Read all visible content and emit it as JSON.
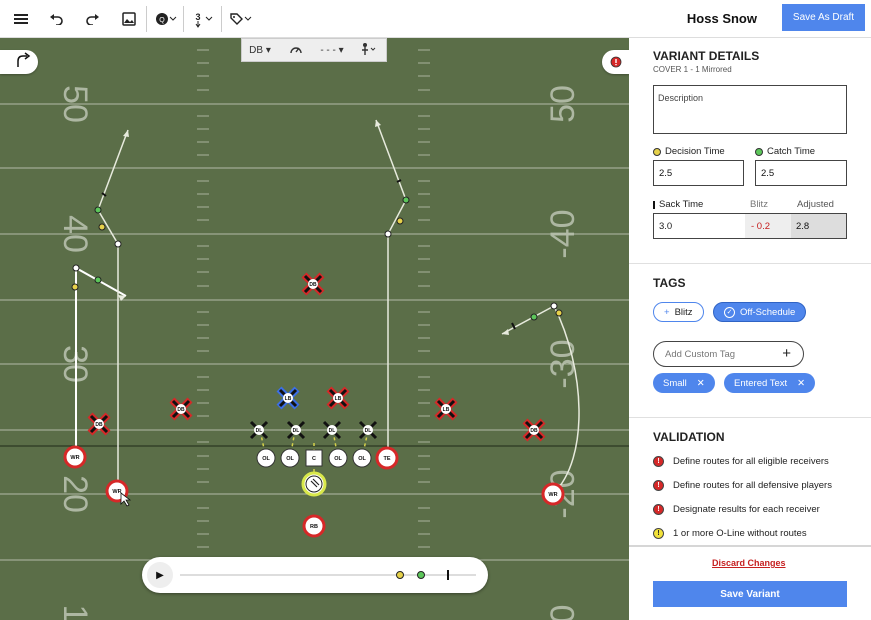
{
  "header": {
    "user_name": "Hoss Snow",
    "save_draft_label": "Save As Draft",
    "icons": [
      "menu-icon",
      "undo-icon",
      "redo-icon",
      "image-icon",
      "formation-icon",
      "motion-icon",
      "tag-icon"
    ]
  },
  "field_toolbar": {
    "player_select": "DB",
    "speed_icon": "gauge-icon",
    "line_style": "- - -",
    "motion_icon": "motion-icon"
  },
  "field": {
    "yard_numbers_left": [
      "50",
      "40",
      "30",
      "20",
      "1"
    ],
    "yard_numbers_right": [
      "50",
      "-40",
      "-30",
      "-20",
      "0"
    ],
    "players": {
      "offense": [
        "WR",
        "WR",
        "OL",
        "OL",
        "C",
        "OL",
        "OL",
        "TE",
        "RB",
        "WR"
      ],
      "defense": [
        "DB",
        "DB",
        "DB",
        "LB",
        "LB",
        "LB",
        "DL",
        "DL",
        "DL",
        "DL",
        "DB"
      ]
    }
  },
  "playback": {
    "play_icon": "play-icon"
  },
  "details": {
    "title": "VARIANT DETAILS",
    "subtitle": "COVER 1 - 1  Mirrored",
    "description_placeholder": "Description",
    "decision_time_label": "Decision Time",
    "decision_time_value": "2.5",
    "catch_time_label": "Catch Time",
    "catch_time_value": "2.5",
    "sack_time_label": "Sack Time",
    "sack_time_value": "3.0",
    "blitz_label": "Blitz",
    "blitz_value": "- 0.2",
    "adjusted_label": "Adjusted",
    "adjusted_value": "2.8"
  },
  "tags": {
    "title": "TAGS",
    "preset": [
      {
        "label": "Blitz",
        "selected": false
      },
      {
        "label": "Off-Schedule",
        "selected": true
      }
    ],
    "custom_placeholder": "Add Custom Tag",
    "applied": [
      "Small",
      "Entered Text"
    ]
  },
  "validation": {
    "title": "VALIDATION",
    "items": [
      {
        "text": "Define routes for all eligible receivers",
        "level": "error"
      },
      {
        "text": "Define routes for all defensive players",
        "level": "error"
      },
      {
        "text": "Designate results for each receiver",
        "level": "error"
      },
      {
        "text": "1 or more O-Line without routes",
        "level": "warning"
      }
    ]
  },
  "footer": {
    "discard_label": "Discard Changes",
    "save_label": "Save Variant"
  },
  "colors": {
    "primary": "#4f86ec",
    "field": "#5b6e48",
    "error": "#d03030",
    "warning": "#f2e23a"
  }
}
